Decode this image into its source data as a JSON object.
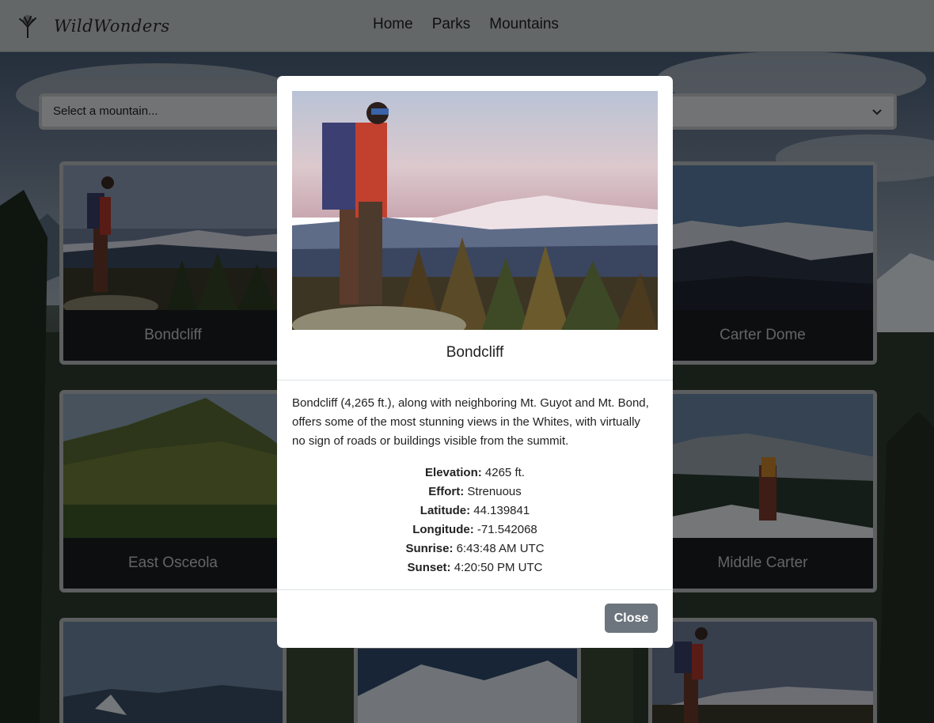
{
  "navbar": {
    "brand": "WildWonders",
    "brand_icon": "tree-icon",
    "links": [
      "Home",
      "Parks",
      "Mountains"
    ]
  },
  "filter": {
    "selected": "Select a mountain..."
  },
  "cards": [
    {
      "title": "Bondcliff"
    },
    {
      "title": "Carter Dome"
    },
    {
      "title": "East Osceola"
    },
    {
      "title": "Middle Carter"
    }
  ],
  "modal": {
    "title": "Bondcliff",
    "description": "Bondcliff (4,265 ft.), along with neighboring Mt. Guyot and Mt. Bond, offers some of the most stunning views in the Whites, with virtually no sign of roads or buildings visible from the summit.",
    "stats": [
      {
        "label": "Elevation:",
        "value": "4265 ft."
      },
      {
        "label": "Effort:",
        "value": "Strenuous"
      },
      {
        "label": "Latitude:",
        "value": "44.139841"
      },
      {
        "label": "Longitude:",
        "value": "-71.542068"
      },
      {
        "label": "Sunrise:",
        "value": "6:43:48 AM UTC"
      },
      {
        "label": "Sunset:",
        "value": "4:20:50 PM UTC"
      }
    ],
    "close_label": "Close"
  },
  "colors": {
    "navbar_bg": "#c7cfd0",
    "close_button": "#6c757d",
    "card_caption_bg": "#1b1d20"
  }
}
